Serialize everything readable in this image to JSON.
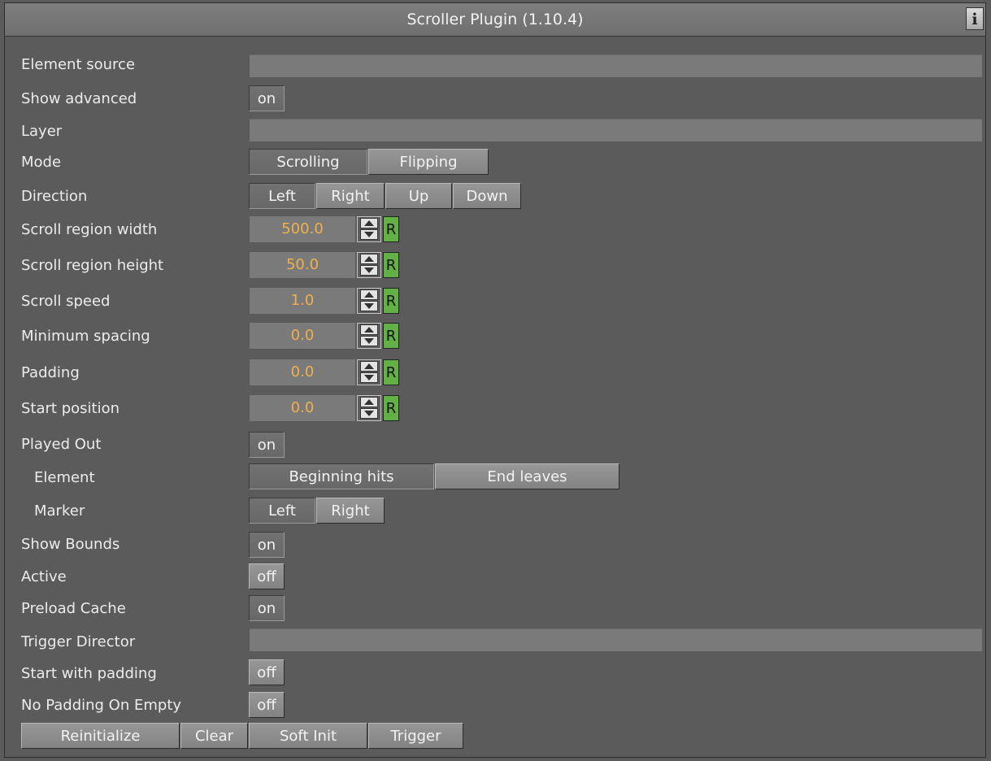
{
  "title": "Scroller Plugin (1.10.4)",
  "info_icon": "i",
  "labels": {
    "element_source": "Element source",
    "show_advanced": "Show advanced",
    "layer": "Layer",
    "mode": "Mode",
    "direction": "Direction",
    "scroll_region_width": "Scroll region width",
    "scroll_region_height": "Scroll region height",
    "scroll_speed": "Scroll speed",
    "minimum_spacing": "Minimum spacing",
    "padding": "Padding",
    "start_position": "Start position",
    "played_out": "Played Out",
    "element": "Element",
    "marker": "Marker",
    "show_bounds": "Show Bounds",
    "active": "Active",
    "preload_cache": "Preload Cache",
    "trigger_director": "Trigger Director",
    "start_with_padding": "Start with padding",
    "no_padding_on_empty": "No Padding On Empty"
  },
  "fields": {
    "element_source": "",
    "layer": "",
    "trigger_director": ""
  },
  "toggles": {
    "show_advanced": "on",
    "played_out": "on",
    "show_bounds": "on",
    "active": "off",
    "preload_cache": "on",
    "start_with_padding": "off",
    "no_padding_on_empty": "off"
  },
  "mode_options": [
    "Scrolling",
    "Flipping"
  ],
  "mode_selected": "Scrolling",
  "direction_options": [
    "Left",
    "Right",
    "Up",
    "Down"
  ],
  "direction_selected": "Left",
  "numbers": {
    "scroll_region_width": "500.0",
    "scroll_region_height": "50.0",
    "scroll_speed": "1.0",
    "minimum_spacing": "0.0",
    "padding": "0.0",
    "start_position": "0.0"
  },
  "reset_label": "R",
  "element_options": [
    "Beginning hits",
    "End leaves"
  ],
  "element_selected": "Beginning hits",
  "marker_options": [
    "Left",
    "Right"
  ],
  "marker_selected": "Left",
  "actions": [
    "Reinitialize",
    "Clear",
    "Soft Init",
    "Trigger"
  ],
  "colors": {
    "background": "#5b5b5b",
    "number_text": "#f0b04c",
    "reset_button": "#62b046"
  }
}
